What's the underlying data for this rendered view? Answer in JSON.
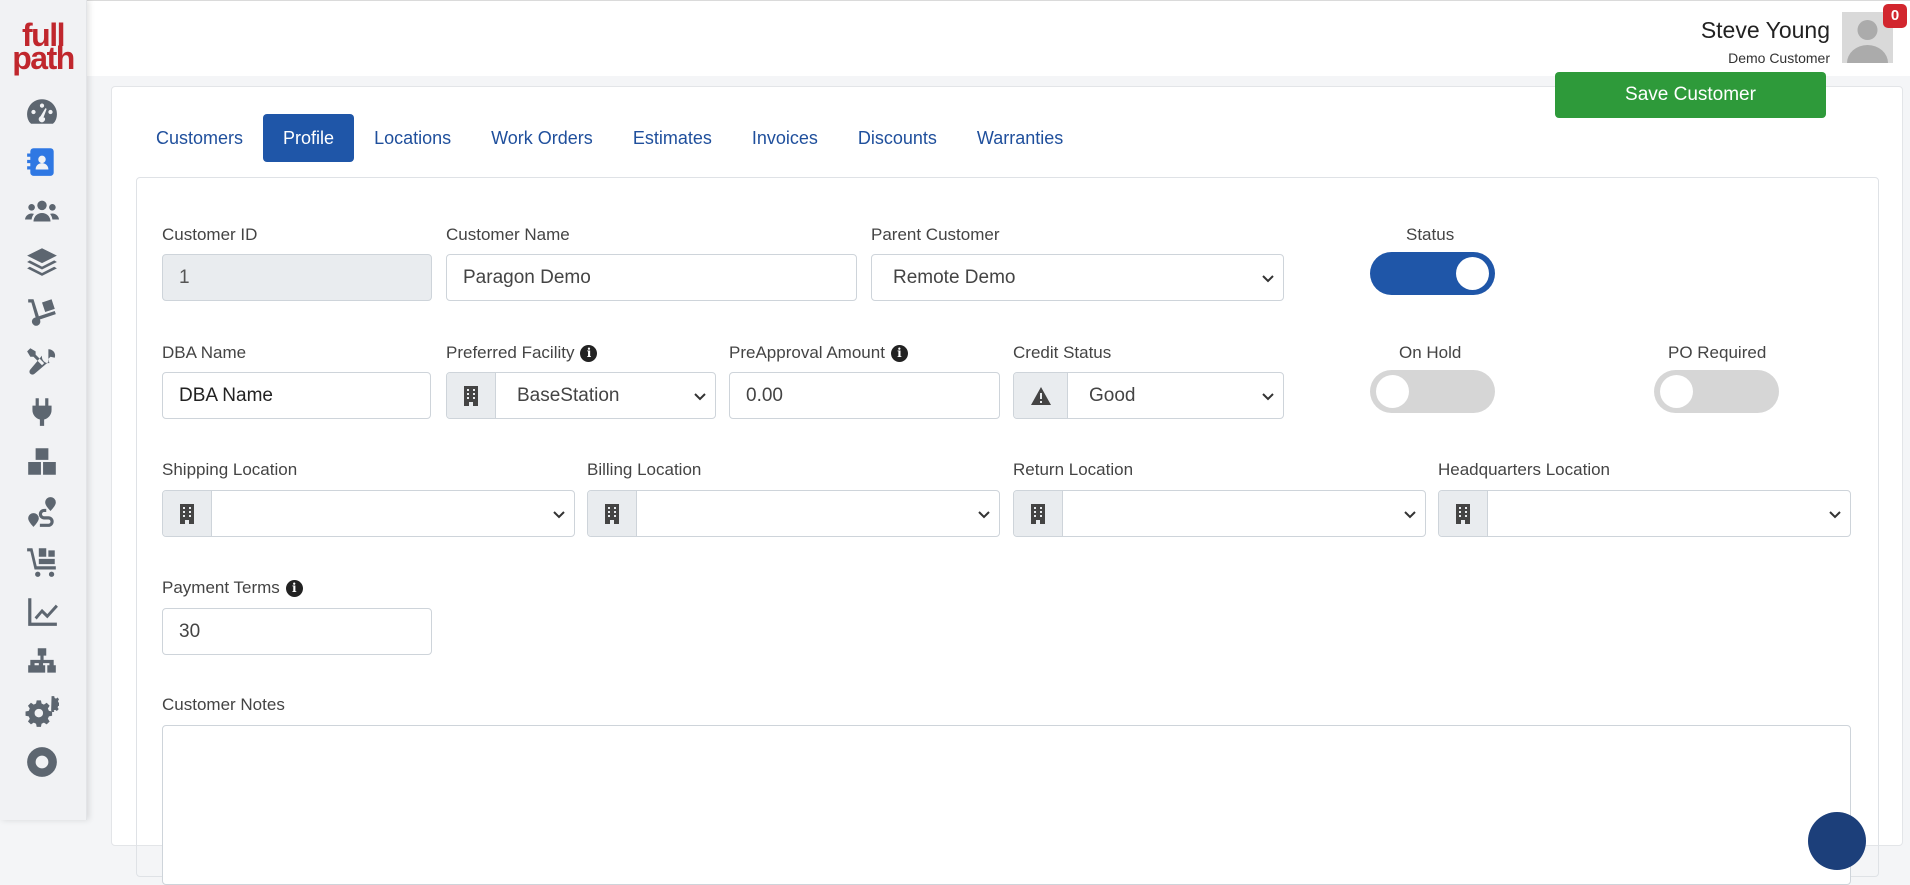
{
  "logo": {
    "line1": "full",
    "line2": "path"
  },
  "sidebar": {
    "icons": [
      {
        "name": "dashboard-icon",
        "active": false
      },
      {
        "name": "contact-book-icon",
        "active": true
      },
      {
        "name": "users-icon",
        "active": false
      },
      {
        "name": "layers-icon",
        "active": false
      },
      {
        "name": "dolly-icon",
        "active": false
      },
      {
        "name": "tools-icon",
        "active": false
      },
      {
        "name": "plug-icon",
        "active": false
      },
      {
        "name": "boxes-icon",
        "active": false
      },
      {
        "name": "route-icon",
        "active": false
      },
      {
        "name": "cart-flatbed-icon",
        "active": false
      },
      {
        "name": "chart-line-icon",
        "active": false
      },
      {
        "name": "sitemap-icon",
        "active": false
      },
      {
        "name": "gears-icon",
        "active": false
      },
      {
        "name": "life-ring-icon",
        "active": false
      }
    ]
  },
  "header": {
    "user_name": "Steve Young",
    "user_role": "Demo Customer",
    "notification_count": "0"
  },
  "tabs": [
    {
      "label": "Customers"
    },
    {
      "label": "Profile",
      "active": true
    },
    {
      "label": "Locations"
    },
    {
      "label": "Work Orders"
    },
    {
      "label": "Estimates"
    },
    {
      "label": "Invoices"
    },
    {
      "label": "Discounts"
    },
    {
      "label": "Warranties"
    }
  ],
  "form": {
    "customer_id": {
      "label": "Customer ID",
      "value": "1"
    },
    "customer_name": {
      "label": "Customer Name",
      "value": "Paragon Demo"
    },
    "parent_customer": {
      "label": "Parent Customer",
      "value": "Remote Demo"
    },
    "status": {
      "label": "Status",
      "on": true
    },
    "save_label": "Save Customer",
    "dba_name": {
      "label": "DBA Name",
      "value": "DBA Name"
    },
    "preferred_facility": {
      "label": "Preferred Facility",
      "value": "BaseStation"
    },
    "preapproval_amount": {
      "label": "PreApproval Amount",
      "value": "0.00"
    },
    "credit_status": {
      "label": "Credit Status",
      "value": "Good"
    },
    "on_hold": {
      "label": "On Hold",
      "on": false
    },
    "po_required": {
      "label": "PO Required",
      "on": false
    },
    "shipping_location": {
      "label": "Shipping Location",
      "value": ""
    },
    "billing_location": {
      "label": "Billing Location",
      "value": ""
    },
    "return_location": {
      "label": "Return Location",
      "value": ""
    },
    "headquarters_location": {
      "label": "Headquarters Location",
      "value": ""
    },
    "payment_terms": {
      "label": "Payment Terms",
      "value": "30"
    },
    "customer_notes": {
      "label": "Customer Notes",
      "value": ""
    }
  },
  "colors": {
    "brand": "#c0272d",
    "primary": "#1f56a8",
    "success": "#2e9a3a",
    "badge": "#d2262e"
  }
}
